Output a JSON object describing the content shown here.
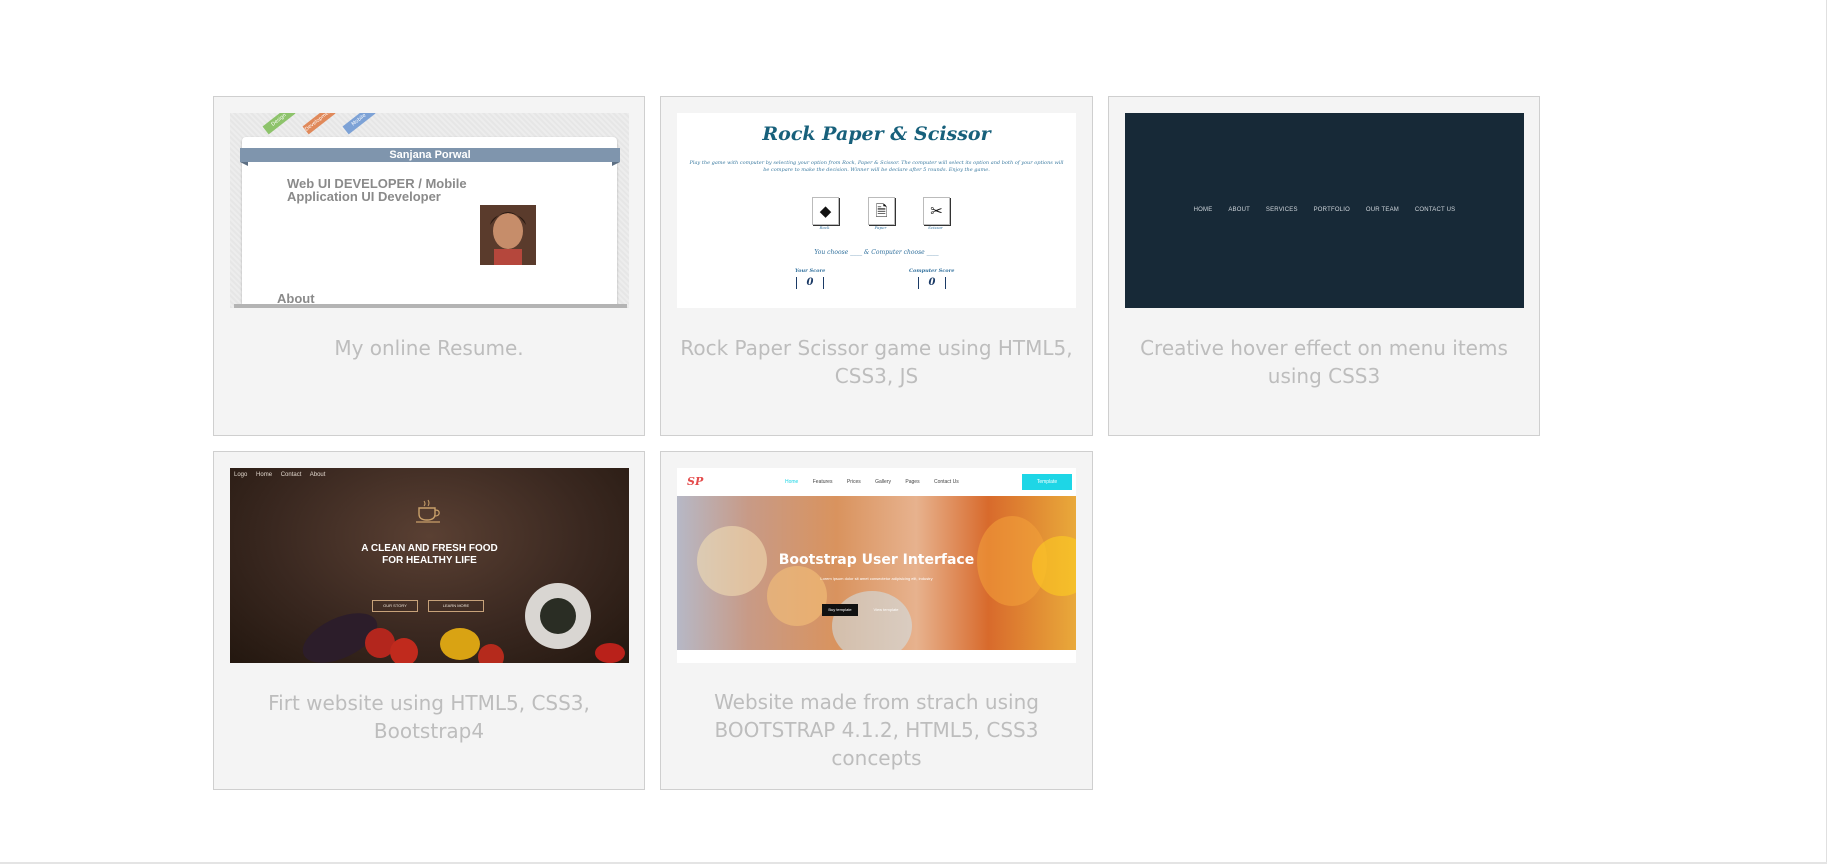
{
  "projects": [
    {
      "caption": "My online Resume.",
      "preview": {
        "ribbons": [
          "Design",
          "Development",
          "Mobile"
        ],
        "name": "Sanjana Porwal",
        "role": "Web UI DEVELOPER / Mobile Application UI Developer",
        "section": "About"
      }
    },
    {
      "caption": "Rock Paper Scissor game using HTML5, CSS3, JS",
      "preview": {
        "title": "Rock Paper & Scissor",
        "description": "Play the game with computer by selecting your option from Rock, Paper & Scissor. The computer will select its option and both of your options will be compare to make the decision. Winner will be declare after 5 rounds. Enjoy the game.",
        "choices": [
          "Rock",
          "Paper",
          "Scissor"
        ],
        "versus": "You choose ____ & Computer choose ____",
        "your_score_label": "Your Score",
        "computer_score_label": "Computer Score",
        "your_score": "0",
        "computer_score": "0"
      }
    },
    {
      "caption": "Creative hover effect on menu items using CSS3",
      "preview": {
        "menu": [
          "HOME",
          "ABOUT",
          "SERVICES",
          "PORTFOLIO",
          "OUR TEAM",
          "CONTACT US"
        ]
      }
    },
    {
      "caption": "Firt website using HTML5, CSS3, Bootstrap4",
      "preview": {
        "logo": "Logo",
        "nav": [
          "Home",
          "Contact",
          "About"
        ],
        "headline_line1": "A CLEAN AND FRESH FOOD",
        "headline_line2": "FOR HEALTHY LIFE",
        "button1": "OUR STORY",
        "button2": "LEARN MORE"
      }
    },
    {
      "caption": "Website made from strach using BOOTSTRAP 4.1.2, HTML5, CSS3 concepts",
      "preview": {
        "logo": "SP",
        "nav": [
          "Home",
          "Features",
          "Prices",
          "Gallery",
          "Pages",
          "Contact Us"
        ],
        "nav_button": "Template",
        "hero_title": "Bootstrap User Interface",
        "hero_subtitle": "Lorem ipsum dolor sit amet consectetur adipisicing elit, industry",
        "hero_button1": "Buy template",
        "hero_button2": "View template"
      }
    }
  ],
  "colors": {
    "card_background": "#f4f4f4",
    "card_border": "#cfcfcf",
    "caption_text": "#bdbdbd",
    "hover_menu_bg": "#172937",
    "rps_title": "#17607b",
    "bootstrap_button": "#1ed6e6"
  }
}
